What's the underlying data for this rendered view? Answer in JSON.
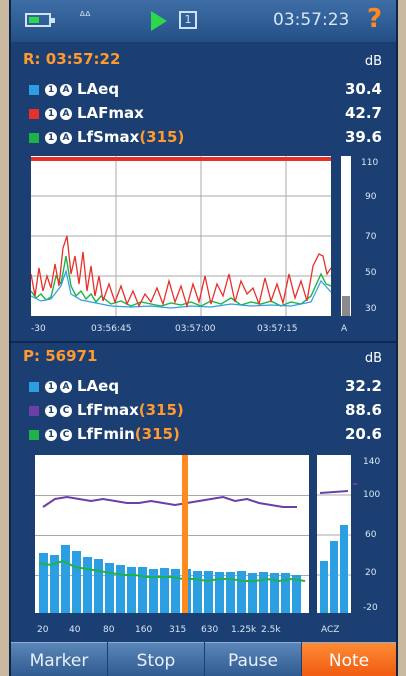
{
  "status": {
    "aa_glyph": "ᐞᐞ",
    "box_glyph": "1",
    "clock": "03:57:23",
    "help": "?"
  },
  "panel1": {
    "title": "R: 03:57:22",
    "unit": "dB",
    "rows": [
      {
        "name": "LAeq",
        "band": "",
        "value": "30.4",
        "color": "#2c9fe2"
      },
      {
        "name": "LAFmax",
        "band": "",
        "value": "42.7",
        "color": "#e8302b"
      },
      {
        "name": "LfSmax",
        "band": "(315)",
        "value": "39.6",
        "color": "#1db34a"
      }
    ],
    "xticks": [
      "-30",
      "03:56:45",
      "03:57:00",
      "03:57:15",
      "A"
    ],
    "yticks": [
      "110",
      "90",
      "70",
      "50",
      "30"
    ]
  },
  "panel2": {
    "title": "P: 56971",
    "unit": "dB",
    "rows": [
      {
        "name": "LAeq",
        "band": "",
        "value": "32.2",
        "color": "#2c9fe2"
      },
      {
        "name": "LfFmax",
        "band": "(315)",
        "value": "88.6",
        "color": "#6b3fa6"
      },
      {
        "name": "LfFmin",
        "band": "(315)",
        "value": "20.6",
        "color": "#1db34a"
      }
    ],
    "xticks": [
      "20",
      "40",
      "80",
      "160",
      "315",
      "630",
      "1.25k",
      "2.5k",
      "ACZ"
    ],
    "yticks": [
      "140",
      "100",
      "60",
      "20",
      "-20"
    ]
  },
  "buttons": {
    "marker": "Marker",
    "stop": "Stop",
    "pause": "Pause",
    "note": "Note"
  },
  "icons": [
    "battery-icon",
    "aa-icon",
    "play-icon",
    "channel-box-icon",
    "help-icon"
  ],
  "colors": {
    "accent": "#ff9a30",
    "screen": "#1b3f72",
    "note_button": "#ef5b12"
  }
}
